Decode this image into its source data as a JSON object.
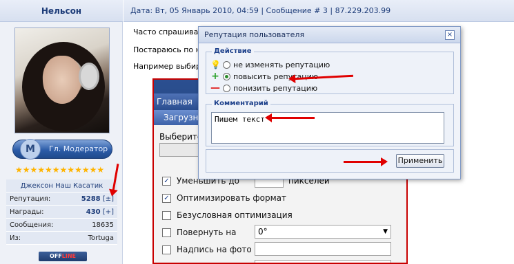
{
  "user": {
    "name": "Нельсон",
    "rank": "Гл. Модератор",
    "stars": "★★★★★★★★★★★★",
    "title": "Джексон Наш Касатик",
    "stats": [
      {
        "label": "Репутация:",
        "value": "5288",
        "action": "[±]"
      },
      {
        "label": "Награды:",
        "value": "430",
        "action": "[+]"
      },
      {
        "label": "Сообщения:",
        "value": "18635",
        "action": ""
      },
      {
        "label": "Из:",
        "value": "Tortuga",
        "action": ""
      }
    ],
    "status_off": "OFF",
    "status_line": "LINE"
  },
  "post": {
    "header": "Дата: Вт, 05 Январь 2010, 04:59 | Сообщение # 3 | 87.229.203.99",
    "lines": [
      "Часто спрашива",
      "Постараюсь по н",
      "Например выбир"
    ]
  },
  "embedded": {
    "nav": "Главная",
    "sub": "Загрузн",
    "select_label": "Выберите",
    "options": [
      {
        "label": "Уменьшить до",
        "checked": true,
        "suffix": "пикселей"
      },
      {
        "label": "Оптимизировать формат",
        "checked": true
      },
      {
        "label": "Безусловная оптимизация",
        "checked": false
      },
      {
        "label": "Повернуть на",
        "checked": false,
        "field": "0°"
      },
      {
        "label": "Надпись на фото",
        "checked": false
      }
    ],
    "checkmark": "✓"
  },
  "modal": {
    "title": "Репутация пользователя",
    "close": "×",
    "action_legend": "Действие",
    "radios": [
      {
        "label": "не изменять репутацию",
        "icon": "bulb-icon",
        "symbol": "💡",
        "selected": false
      },
      {
        "label": "повысить репутацию",
        "icon": "plus-icon",
        "symbol": "+",
        "selected": true
      },
      {
        "label": "понизить репутацию",
        "icon": "minus-icon",
        "symbol": "—",
        "selected": false
      }
    ],
    "comment_legend": "Комментарий",
    "comment_value": "Пишем текст",
    "apply_label": "Применить"
  },
  "colors": {
    "accent": "#1c3b78",
    "arrow": "#e00000",
    "plus": "#2aa12a",
    "minus": "#e02020"
  }
}
